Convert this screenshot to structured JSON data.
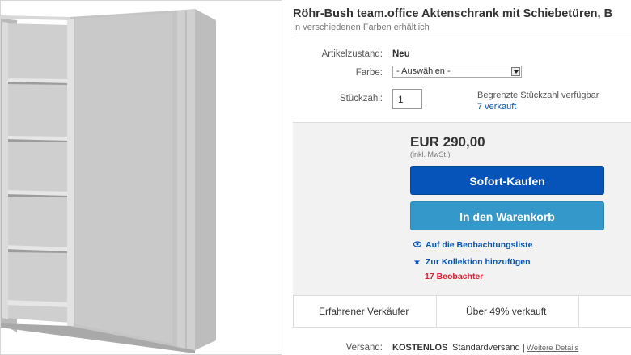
{
  "product": {
    "title": "Röhr-Bush team.office Aktenschrank mit Schiebetüren, B",
    "subtitle": "In verschiedenen Farben erhältlich"
  },
  "details": {
    "condition_label": "Artikelzustand:",
    "condition_value": "Neu",
    "color_label": "Farbe:",
    "color_select_value": "- Auswählen -",
    "quantity_label": "Stückzahl:",
    "quantity_value": "1",
    "availability_text": "Begrenzte Stückzahl verfügbar",
    "sold_count_link": "7 verkauft"
  },
  "purchase": {
    "price": "EUR 290,00",
    "price_note": "(inkl. MwSt.)",
    "buy_now_label": "Sofort-Kaufen",
    "add_to_cart_label": "In den Warenkorb",
    "watchlist_label": "Auf die Beobachtungsliste",
    "collection_label": "Zur Kollektion hinzufügen",
    "watchers_label": "17 Beobachter",
    "seller_badge": "Erfahrener Verkäufer",
    "sold_percent": "Über 49% verkauft"
  },
  "shipping": {
    "label": "Versand:",
    "free_label": "KOSTENLOS",
    "type_label": "Standardversand |",
    "details_link": "Weitere Details"
  },
  "icons": {
    "watch": "eye-icon",
    "collection": "star-icon",
    "dropdown": "chevron-down-icon"
  },
  "colors": {
    "link": "#0654ba",
    "buy_now_button": "#0654ba",
    "cart_button": "#3498ca",
    "watchers": "#dd1e31",
    "price_box": "#f2f2f2"
  }
}
